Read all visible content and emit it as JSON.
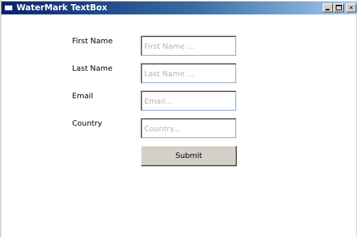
{
  "window": {
    "title": "WaterMark TextBox",
    "controls": {
      "minimize": "minimize",
      "maximize": "maximize",
      "close": "✕"
    }
  },
  "form": {
    "fields": [
      {
        "label": "First Name",
        "placeholder": "First Name ..."
      },
      {
        "label": "Last Name",
        "placeholder": "Last Name ..."
      },
      {
        "label": "Email",
        "placeholder": "Email..."
      },
      {
        "label": "Country",
        "placeholder": "Country..."
      }
    ],
    "submit_label": "Submit"
  },
  "colors": {
    "titlebar_start": "#0a246a",
    "titlebar_end": "#a6caf0",
    "button_face": "#d4d0c8",
    "placeholder": "#b4b4b4"
  }
}
